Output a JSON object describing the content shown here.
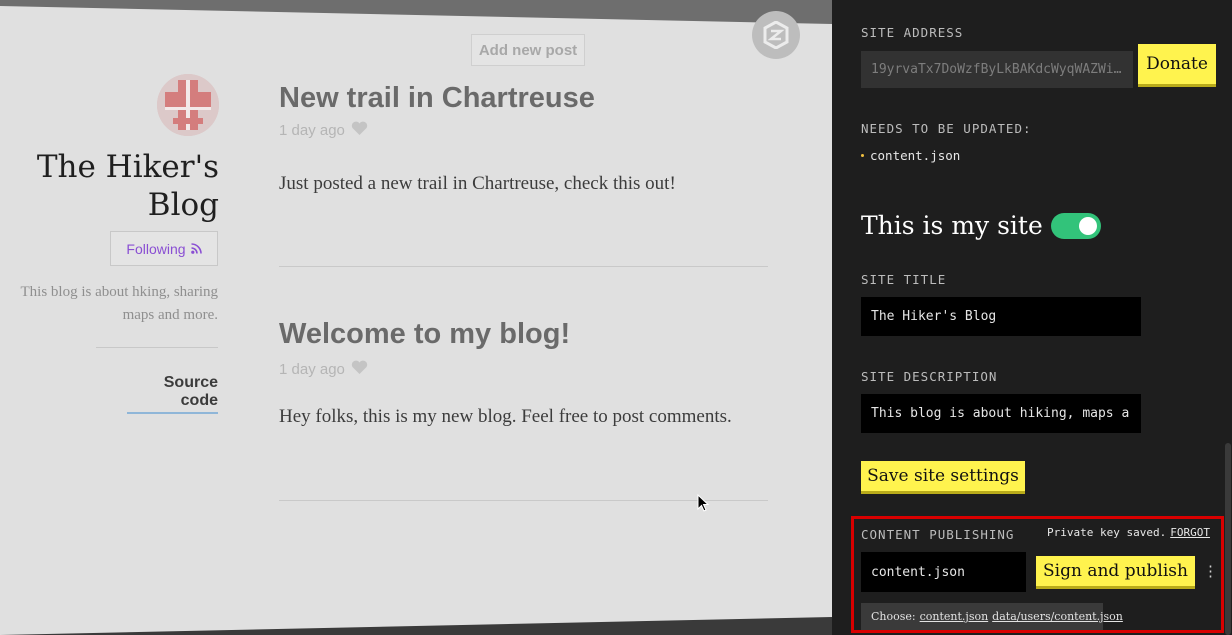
{
  "blog": {
    "add_post_label": "Add new post",
    "title": "The Hiker's Blog",
    "follow_label": "Following",
    "description": "This blog is about hking, sharing maps and more.",
    "source_link": "Source code",
    "posts": [
      {
        "title": "New trail in Chartreuse",
        "date": "1 day ago",
        "body": "Just posted a new trail in Chartreuse, check this out!"
      },
      {
        "title": "Welcome to my blog!",
        "date": "1 day ago",
        "body": "Hey folks, this is my new blog. Feel free to post comments."
      }
    ]
  },
  "sidebar": {
    "site_address_label": "SITE ADDRESS",
    "site_address_value": "19yrvaTx7DoWzfByLkBAKdcWyqWAZWi…",
    "donate_label": "Donate",
    "needs_update_label": "NEEDS TO BE UPDATED:",
    "needs_update_items": [
      "content.json"
    ],
    "my_site_label": "This is my site",
    "my_site_toggle": true,
    "site_title_label": "SITE TITLE",
    "site_title_value": "The Hiker's Blog",
    "site_description_label": "SITE DESCRIPTION",
    "site_description_value": "This blog is about hiking, maps a",
    "save_label": "Save site settings",
    "content_publishing_label": "CONTENT PUBLISHING",
    "private_key_text": "Private key saved.",
    "forgot_label": "FORGOT",
    "publish_file_value": "content.json",
    "sign_publish_label": "Sign and publish",
    "choose_label": "Choose:",
    "choose_options": [
      "content.json",
      "data/users/content.json"
    ]
  },
  "colors": {
    "accent_yellow": "#fff34e",
    "toggle_green": "#32c37a",
    "highlight_red": "#d90000",
    "follow_purple": "#8a4fd3"
  }
}
